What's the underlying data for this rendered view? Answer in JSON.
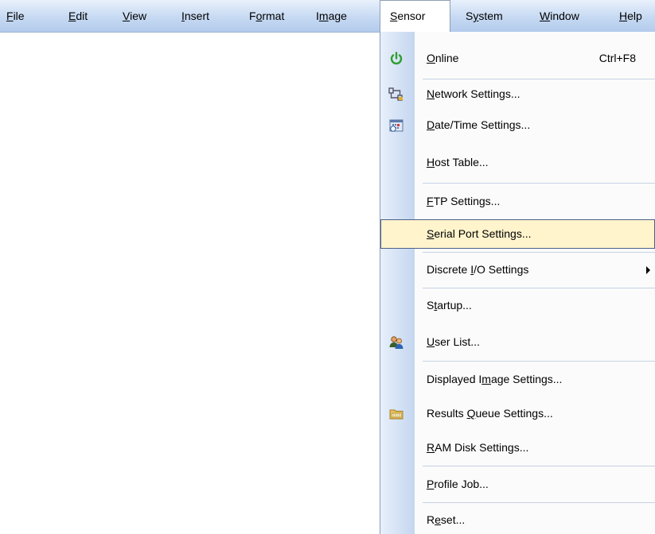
{
  "menubar": {
    "items": [
      {
        "label": "File",
        "accel": "F",
        "rest": "ile"
      },
      {
        "label": "Edit",
        "accel": "E",
        "rest": "dit"
      },
      {
        "label": "View",
        "accel": "V",
        "rest": "iew"
      },
      {
        "label": "Insert",
        "accel": "I",
        "rest": "nsert"
      },
      {
        "label": "Format",
        "pre": "F",
        "accel": "o",
        "rest": "rmat"
      },
      {
        "label": "Image",
        "pre": "I",
        "accel": "m",
        "rest": "age"
      },
      {
        "label": "Sensor",
        "pre": "",
        "accel": "S",
        "rest": "ensor"
      },
      {
        "label": "System",
        "pre": "S",
        "accel": "y",
        "rest": "stem"
      },
      {
        "label": "Window",
        "accel": "W",
        "rest": "indow"
      },
      {
        "label": "Help",
        "accel": "H",
        "rest": "elp"
      }
    ]
  },
  "sensor_menu": {
    "items": [
      {
        "pre": "",
        "accel": "O",
        "rest": "nline",
        "shortcut": "Ctrl+F8",
        "icon": "power-icon"
      },
      {
        "pre": "",
        "accel": "N",
        "rest": "etwork Settings...",
        "icon": "network-icon"
      },
      {
        "pre": "",
        "accel": "D",
        "rest": "ate/Time Settings...",
        "icon": "calendar-clock-icon"
      },
      {
        "pre": "",
        "accel": "H",
        "rest": "ost Table..."
      },
      {
        "pre": "",
        "accel": "F",
        "rest": "TP Settings..."
      },
      {
        "pre": "",
        "accel": "S",
        "rest": "erial Port Settings...",
        "highlighted": true
      },
      {
        "pre": "Discrete ",
        "accel": "I",
        "rest": "/O Settings",
        "submenu": true
      },
      {
        "pre": "S",
        "accel": "t",
        "rest": "artup..."
      },
      {
        "pre": "",
        "accel": "U",
        "rest": "ser List...",
        "icon": "users-icon"
      },
      {
        "pre": "Displayed I",
        "accel": "m",
        "rest": "age Settings..."
      },
      {
        "pre": "Results ",
        "accel": "Q",
        "rest": "ueue Settings...",
        "icon": "folder-icon"
      },
      {
        "pre": "",
        "accel": "R",
        "rest": "AM Disk Settings..."
      },
      {
        "pre": "",
        "accel": "P",
        "rest": "rofile Job..."
      },
      {
        "pre": "R",
        "accel": "e",
        "rest": "set..."
      }
    ]
  }
}
